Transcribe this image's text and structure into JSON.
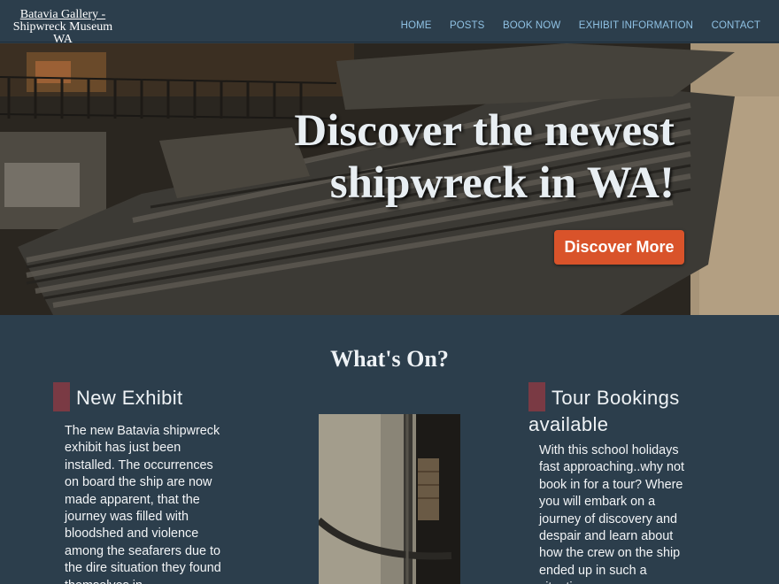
{
  "header": {
    "brand_line1": "Batavia Gallery -",
    "brand_line2": "Shipwreck Museum WA",
    "nav": [
      "HOME",
      "POSTS",
      "BOOK NOW",
      "EXHIBIT INFORMATION",
      "CONTACT"
    ]
  },
  "hero": {
    "title_line1": "Discover the newest",
    "title_line2": "shipwreck in WA!",
    "button_label": "Discover More"
  },
  "whats_on": {
    "heading": "What's On?",
    "left": {
      "title": "New Exhibit",
      "text": "The new Batavia shipwreck exhibit has just been installed. The occurrences on board the ship are now made apparent, that the journey was filled with bloodshed and violence among the seafarers due to the dire situation they found themselves in."
    },
    "right": {
      "title_line1": "Tour Bookings",
      "title_line2": "available",
      "text": "With this school holidays fast approaching..why not book in for a tour? Where you will embark on a journey of discovery and despair and learn about how the crew on the ship ended up in such a situation."
    }
  },
  "colors": {
    "page_bg": "#2c3e4c",
    "nav_link": "#8fc1e3",
    "accent_button": "#d9532a",
    "title_marker": "#7a3a44"
  }
}
